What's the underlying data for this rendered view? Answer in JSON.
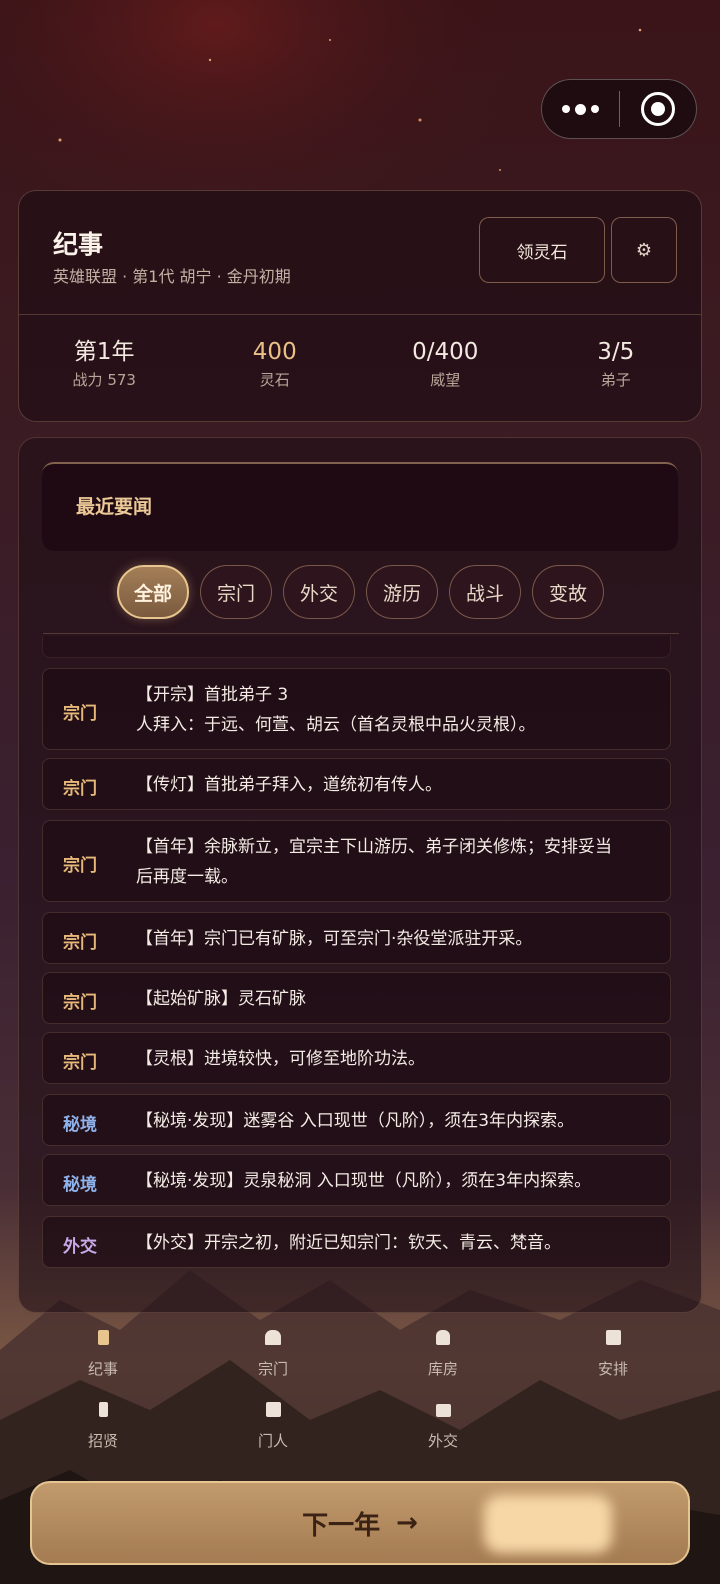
{
  "header": {
    "title": "纪事",
    "subtitle": "英雄联盟 · 第1代 胡宁 · 金丹初期",
    "claim_label": "领灵石",
    "settings_icon": "gear-icon",
    "stats": [
      {
        "value": "第1年",
        "label": "战力 573"
      },
      {
        "value": "400",
        "label": "灵石"
      },
      {
        "value": "0/400",
        "label": "威望"
      },
      {
        "value": "3/5",
        "label": "弟子"
      }
    ]
  },
  "news": {
    "heading": "最近要闻",
    "filters": [
      "全部",
      "宗门",
      "外交",
      "游历",
      "战斗",
      "变故"
    ],
    "active_filter": "全部",
    "entries": [
      {
        "tag": "宗门",
        "lines": [
          "【开宗】首批弟子 3",
          "人拜入：于远、何萱、胡云（首名灵根中品火灵根）。"
        ]
      },
      {
        "tag": "宗门",
        "lines": [
          "【传灯】首批弟子拜入，道统初有传人。"
        ]
      },
      {
        "tag": "宗门",
        "lines": [
          "【首年】余脉新立，宜宗主下山游历、弟子闭关修炼；安排妥当",
          "后再度一载。"
        ]
      },
      {
        "tag": "宗门",
        "lines": [
          "【首年】宗门已有矿脉，可至宗门·杂役堂派驻开采。"
        ]
      },
      {
        "tag": "宗门",
        "lines": [
          "【起始矿脉】灵石矿脉"
        ]
      },
      {
        "tag": "宗门",
        "lines": [
          "【灵根】进境较快，可修至地阶功法。"
        ]
      },
      {
        "tag": "秘境",
        "lines": [
          "【秘境·发现】迷雾谷 入口现世（凡阶），须在3年内探索。"
        ]
      },
      {
        "tag": "秘境",
        "lines": [
          "【秘境·发现】灵泉秘洞 入口现世（凡阶），须在3年内探索。"
        ]
      },
      {
        "tag": "外交",
        "lines": [
          "【外交】开宗之初，附近已知宗门：钦天、青云、梵音。"
        ]
      }
    ]
  },
  "nav": {
    "items": [
      {
        "label": "纪事",
        "icon": "scroll-icon"
      },
      {
        "label": "宗门",
        "icon": "gate-icon"
      },
      {
        "label": "库房",
        "icon": "vault-icon"
      },
      {
        "label": "安排",
        "icon": "grid-icon"
      },
      {
        "label": "招贤",
        "icon": "banner-icon"
      },
      {
        "label": "门人",
        "icon": "people-icon"
      },
      {
        "label": "外交",
        "icon": "handshake-icon"
      }
    ]
  },
  "next_button": {
    "label": "下一年",
    "arrow": "→"
  },
  "colors": {
    "accent_gold": "#e9c187",
    "sect_tag": "#e6b879",
    "realm_tag": "#8fb2ea",
    "diplomacy_tag": "#c7a9e8",
    "button_gold": "#b68c60"
  }
}
